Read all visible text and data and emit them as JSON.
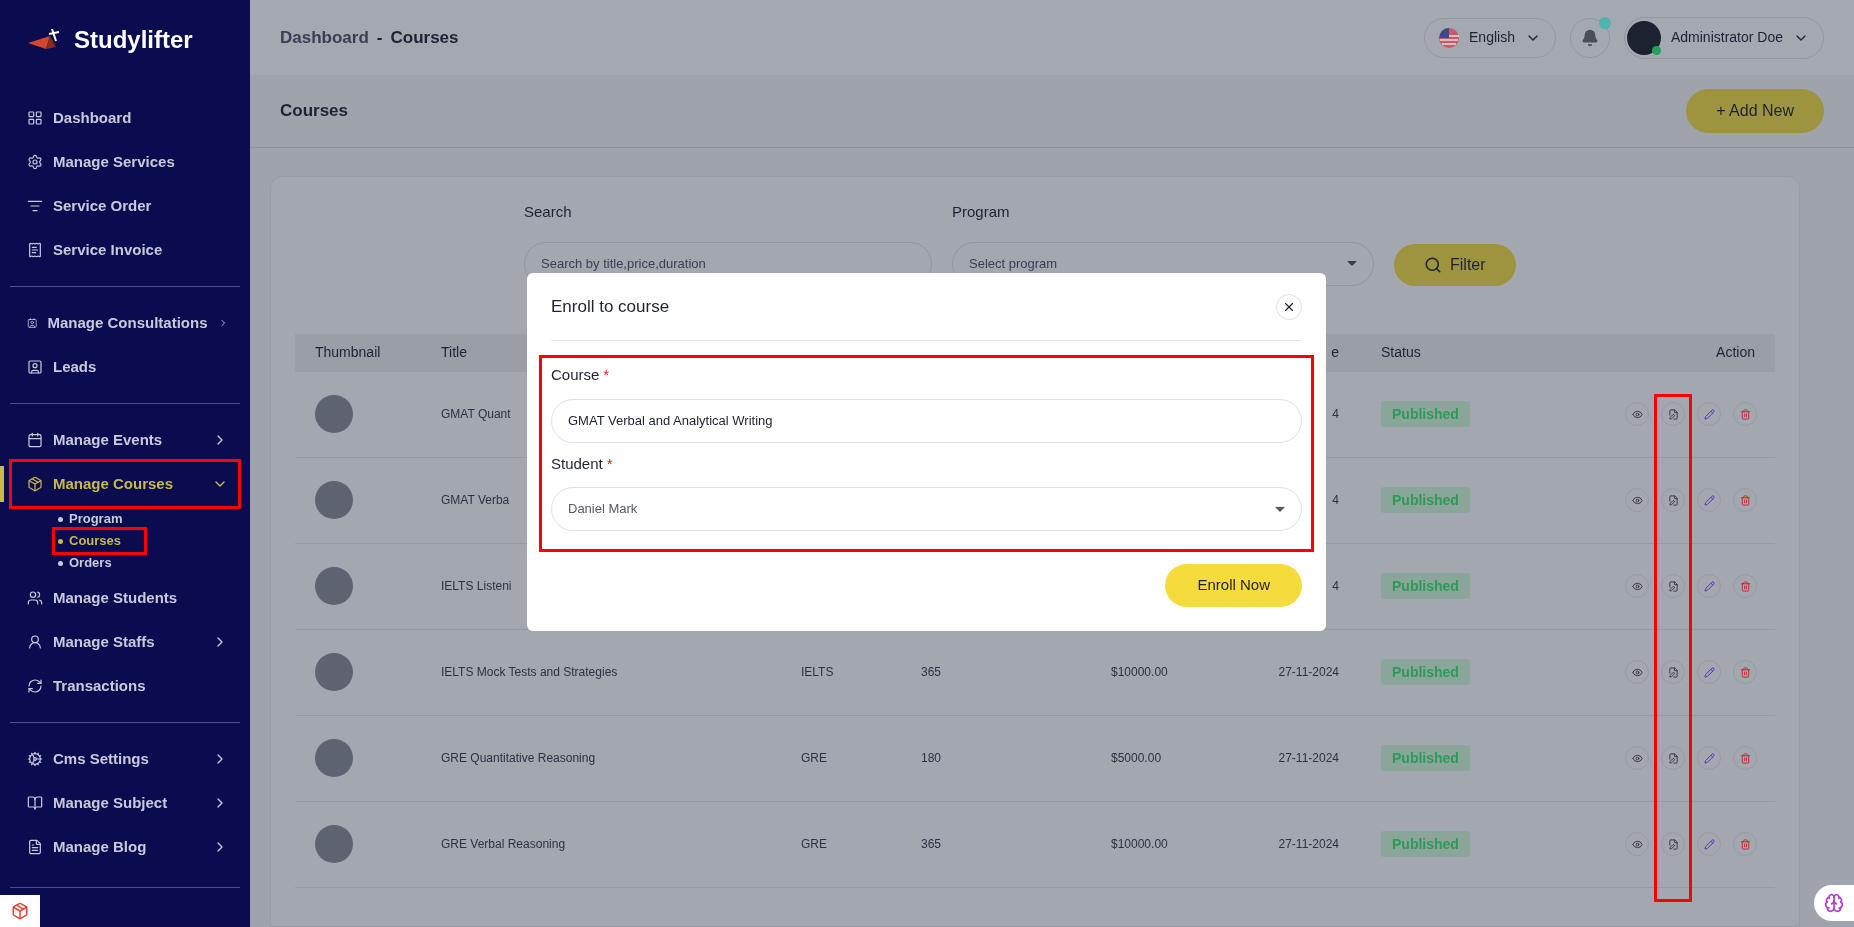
{
  "logo": {
    "text": "Studylifter"
  },
  "sidebar": {
    "sections": [
      [
        {
          "label": "Dashboard",
          "selected": false,
          "expandable": false
        },
        {
          "label": "Manage Services",
          "selected": false,
          "expandable": false
        },
        {
          "label": "Service Order",
          "selected": false,
          "expandable": false
        },
        {
          "label": "Service Invoice",
          "selected": false,
          "expandable": false
        }
      ],
      [
        {
          "label": "Manage Consultations",
          "selected": false,
          "expandable": true,
          "expanded": false
        },
        {
          "label": "Leads",
          "selected": false,
          "expandable": false
        }
      ],
      [
        {
          "label": "Manage Events",
          "selected": false,
          "expandable": true,
          "expanded": false
        },
        {
          "label": "Manage Courses",
          "selected": true,
          "highlighted": true,
          "expandable": true,
          "expanded": true,
          "children": [
            {
              "label": "Program",
              "selected": false,
              "highlighted": false
            },
            {
              "label": "Courses",
              "selected": true,
              "highlighted": true
            },
            {
              "label": "Orders",
              "selected": false,
              "highlighted": false
            }
          ]
        },
        {
          "label": "Manage Students",
          "selected": false,
          "expandable": false
        },
        {
          "label": "Manage Staffs",
          "selected": false,
          "expandable": true,
          "expanded": false
        },
        {
          "label": "Transactions",
          "selected": false,
          "expandable": false
        }
      ],
      [
        {
          "label": "Cms Settings",
          "selected": false,
          "expandable": true,
          "expanded": false
        },
        {
          "label": "Manage Subject",
          "selected": false,
          "expandable": true,
          "expanded": false
        },
        {
          "label": "Manage Blog",
          "selected": false,
          "expandable": true,
          "expanded": false
        }
      ]
    ]
  },
  "breadcrumb": {
    "parent": "Dashboard",
    "separator": "-",
    "current": "Courses"
  },
  "topbar": {
    "language": "English",
    "notification_dot": true,
    "user": "Administrator Doe",
    "online": true
  },
  "page": {
    "title": "Courses",
    "add_button": "+ Add New"
  },
  "filters": {
    "search_label": "Search",
    "search_placeholder": "Search by title,price,duration",
    "program_label": "Program",
    "program_placeholder": "Select program",
    "filter_button": "Filter"
  },
  "table": {
    "header": {
      "thumbnail": "Thumbnail",
      "title": "Title",
      "column_6": "e",
      "status": "Status",
      "action": "Action"
    },
    "enroll_column_highlighted": true,
    "rows": [
      {
        "title": "GMAT Quant",
        "date": "4",
        "status": "Published"
      },
      {
        "title": "GMAT Verba",
        "date": "4",
        "status": "Published"
      },
      {
        "title": "IELTS Listeni",
        "date": "4",
        "status": "Published"
      },
      {
        "title": "IELTS Mock Tests and Strategies",
        "program": "IELTS",
        "duration": "365",
        "price": "$10000.00",
        "date": "27-11-2024",
        "status": "Published"
      },
      {
        "title": "GRE Quantitative Reasoning",
        "program": "GRE",
        "duration": "180",
        "price": "$5000.00",
        "date": "27-11-2024",
        "status": "Published"
      },
      {
        "title": "GRE Verbal Reasoning",
        "program": "GRE",
        "duration": "365",
        "price": "$10000.00",
        "date": "27-11-2024",
        "status": "Published"
      }
    ]
  },
  "modal": {
    "title": "Enroll to course",
    "highlighted": true,
    "required_mark": "*",
    "fields": [
      {
        "label": "Course",
        "required": true,
        "kind": "text",
        "value": "GMAT Verbal and Analytical Writing"
      },
      {
        "label": "Student",
        "required": true,
        "kind": "select",
        "value": "Daniel Mark"
      }
    ],
    "submit": "Enroll Now"
  }
}
